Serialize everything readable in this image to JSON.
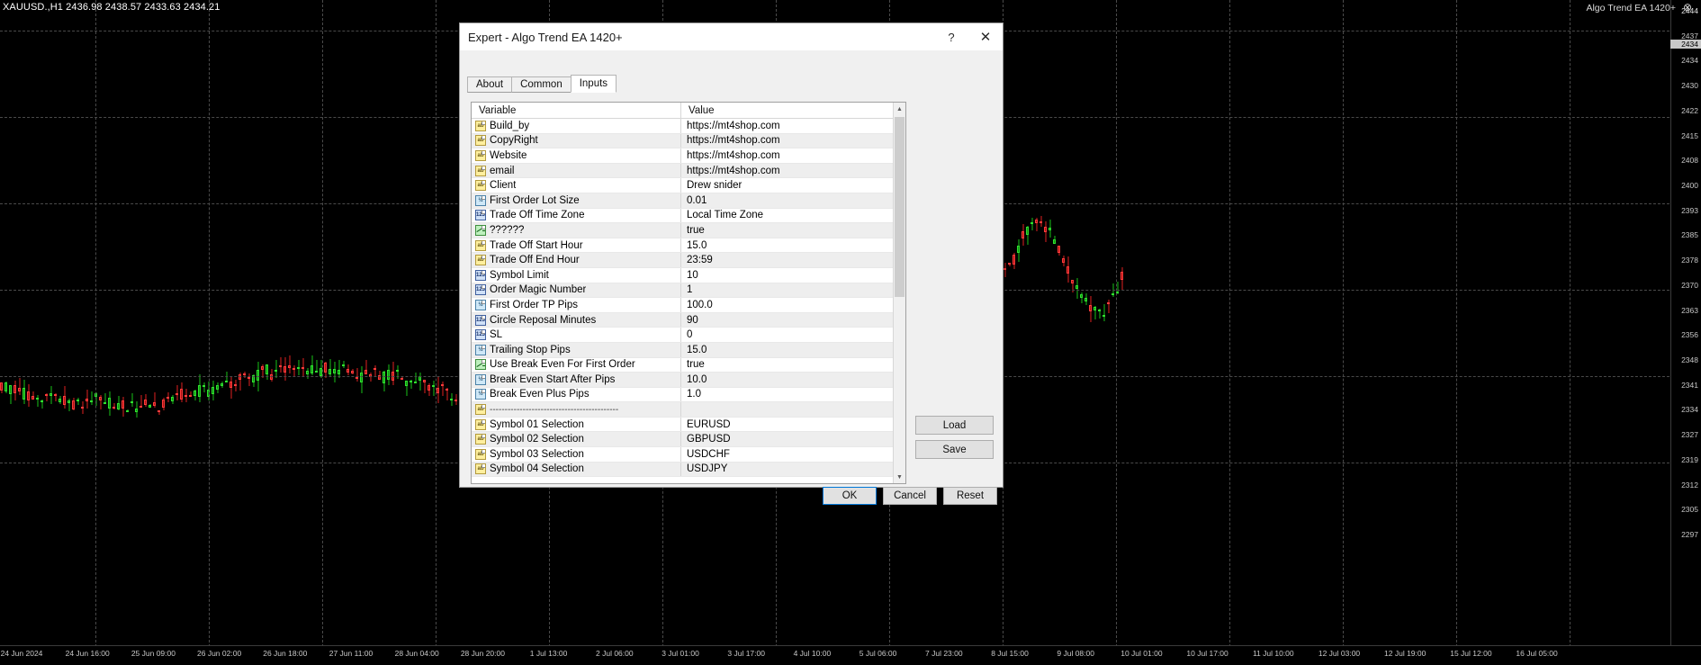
{
  "chart": {
    "header": "XAUUSD.,H1  2436.98 2438.57 2433.63 2434.21",
    "ea_label": "Algo Trend EA 1420+",
    "ea_icon": "⊗",
    "price_ticks": [
      "2444",
      "2437",
      "2434",
      "2430",
      "2422",
      "2415",
      "2408",
      "2400",
      "2393",
      "2385",
      "2378",
      "2370",
      "2363",
      "2356",
      "2348",
      "2341",
      "2334",
      "2327",
      "2319",
      "2312",
      "2305",
      "2297"
    ],
    "price_current": "2434",
    "time_ticks": [
      "24 Jun 2024",
      "24 Jun 16:00",
      "25 Jun 09:00",
      "26 Jun 02:00",
      "26 Jun 18:00",
      "27 Jun 11:00",
      "28 Jun 04:00",
      "28 Jun 20:00",
      "1 Jul 13:00",
      "2 Jul 06:00",
      "3 Jul 01:00",
      "3 Jul 17:00",
      "4 Jul 10:00",
      "5 Jul 06:00",
      "7 Jul 23:00",
      "8 Jul 15:00",
      "9 Jul 08:00",
      "10 Jul 01:00",
      "10 Jul 17:00",
      "11 Jul 10:00",
      "12 Jul 03:00",
      "12 Jul 19:00",
      "15 Jul 12:00",
      "16 Jul 05:00"
    ]
  },
  "dialog": {
    "title": "Expert - Algo Trend EA 1420+",
    "help_label": "?",
    "close_label": "✕",
    "tabs": [
      {
        "label": "About",
        "active": false
      },
      {
        "label": "Common",
        "active": false
      },
      {
        "label": "Inputs",
        "active": true
      }
    ],
    "table": {
      "headers": {
        "variable": "Variable",
        "value": "Value"
      },
      "rows": [
        {
          "type": "string",
          "variable": "Build_by",
          "value": "https://mt4shop.com"
        },
        {
          "type": "string",
          "variable": "CopyRight",
          "value": "https://mt4shop.com"
        },
        {
          "type": "string",
          "variable": "Website",
          "value": "https://mt4shop.com"
        },
        {
          "type": "string",
          "variable": "email",
          "value": "https://mt4shop.com"
        },
        {
          "type": "string",
          "variable": "Client",
          "value": "Drew snider"
        },
        {
          "type": "double",
          "variable": "First Order Lot Size",
          "value": "0.01"
        },
        {
          "type": "integer",
          "variable": "Trade Off Time Zone",
          "value": "Local Time Zone"
        },
        {
          "type": "bool",
          "variable": "??????",
          "value": "true"
        },
        {
          "type": "string",
          "variable": "Trade Off Start Hour",
          "value": "15.0"
        },
        {
          "type": "string",
          "variable": "Trade Off End Hour",
          "value": "23:59"
        },
        {
          "type": "integer",
          "variable": "Symbol Limit",
          "value": "10"
        },
        {
          "type": "integer",
          "variable": "Order Magic Number",
          "value": "1"
        },
        {
          "type": "double",
          "variable": "First Order TP Pips",
          "value": "100.0"
        },
        {
          "type": "integer",
          "variable": "Circle Reposal Minutes",
          "value": "90"
        },
        {
          "type": "integer",
          "variable": "SL",
          "value": "0"
        },
        {
          "type": "double",
          "variable": "Trailing Stop Pips",
          "value": "15.0"
        },
        {
          "type": "bool",
          "variable": "Use Break Even For First Order",
          "value": "true"
        },
        {
          "type": "double",
          "variable": "Break Even Start After Pips",
          "value": "10.0"
        },
        {
          "type": "double",
          "variable": "Break Even Plus Pips",
          "value": "1.0"
        },
        {
          "type": "string",
          "variable": "-------------------------------------------",
          "value": "",
          "separator": true
        },
        {
          "type": "string",
          "variable": "Symbol 01 Selection",
          "value": "EURUSD"
        },
        {
          "type": "string",
          "variable": "Symbol 02 Selection",
          "value": "GBPUSD"
        },
        {
          "type": "string",
          "variable": "Symbol 03 Selection",
          "value": "USDCHF"
        },
        {
          "type": "string",
          "variable": "Symbol 04 Selection",
          "value": "USDJPY"
        }
      ]
    },
    "side_buttons": {
      "load": "Load",
      "save": "Save"
    },
    "bottom_buttons": {
      "ok": "OK",
      "cancel": "Cancel",
      "reset": "Reset"
    },
    "scroll": {
      "up_glyph": "▲",
      "down_glyph": "▼"
    }
  }
}
